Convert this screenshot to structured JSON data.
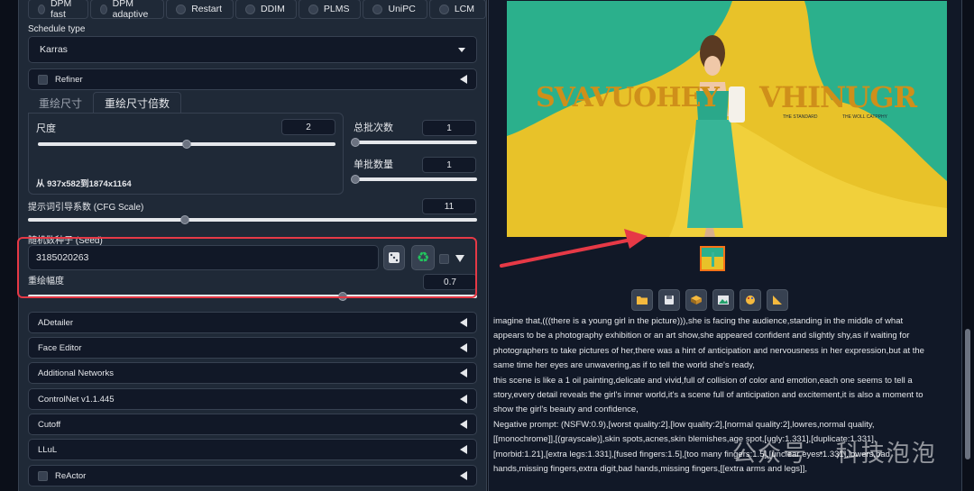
{
  "samplers": [
    "DPM fast",
    "DPM adaptive",
    "Restart",
    "DDIM",
    "PLMS",
    "UniPC",
    "LCM"
  ],
  "schedule": {
    "label": "Schedule type",
    "value": "Karras"
  },
  "refiner": {
    "label": "Refiner"
  },
  "tabs": [
    "重绘尺寸",
    "重绘尺寸倍数"
  ],
  "scale": {
    "label": "尺度",
    "value": "2",
    "level": 0.5,
    "from_to": "从 937x582到1874x1164"
  },
  "batch_count": {
    "label": "总批次数",
    "value": "1",
    "level": 0.0
  },
  "batch_size": {
    "label": "单批数量",
    "value": "1",
    "level": 0.0
  },
  "cfg": {
    "label": "提示词引导系数 (CFG Scale)",
    "value": "11",
    "level": 0.35
  },
  "seed": {
    "label": "随机数种子 (Seed)",
    "value": "3185020263"
  },
  "denoise": {
    "label": "重绘幅度",
    "value": "0.7",
    "level": 0.7
  },
  "accordions": [
    "ADetailer",
    "Face Editor",
    "Additional Networks",
    "ControlNet v1.1.445",
    "Cutoff",
    "LLuL",
    "ReActor"
  ],
  "image_text": {
    "left": "SVAVUOHEY",
    "right": "VHINUGR",
    "sub1": "THE STANDARD",
    "sub2": "THE WOLL CATPPHY"
  },
  "info_lines": [
    "imagine that,(((there is a young girl in the picture))),she is facing the audience,standing in the middle of what",
    "appears to be a photography exhibition or an art show,she appeared confident and slightly shy,as if waiting for",
    "photographers to take pictures of her,there was a hint of anticipation and nervousness in her expression,but at the",
    "same time her eyes are unwavering,as if to tell the world she's ready,",
    "this scene is like a 1 oil painting,delicate and vivid,full of collision of color and emotion,each one seems to tell a",
    "story,every detail reveals the girl's inner world,it's a scene full of anticipation and excitement,it is also a moment to",
    "show the girl's beauty and confidence,",
    "Negative prompt: (NSFW:0.9),[worst quality:2],[low quality:2],[normal quality:2],lowres,normal quality,",
    "[[monochrome]],[(grayscale)],skin spots,acnes,skin blemishes,age spot,[ugly:1.331],[duplicate:1.331],",
    "[morbid:1.21],[extra legs:1.331],[fused fingers:1.5],[too many fingers:1.5],[unclear eyes:1.331],lowers,bad",
    "hands,missing fingers,extra digit,bad hands,missing fingers,[[extra arms and legs]],"
  ],
  "watermark": "公众号 · 科技泡泡",
  "colors": {
    "highlight": "#e63946",
    "accent": "#f97316",
    "recycle": "#22c55e"
  }
}
